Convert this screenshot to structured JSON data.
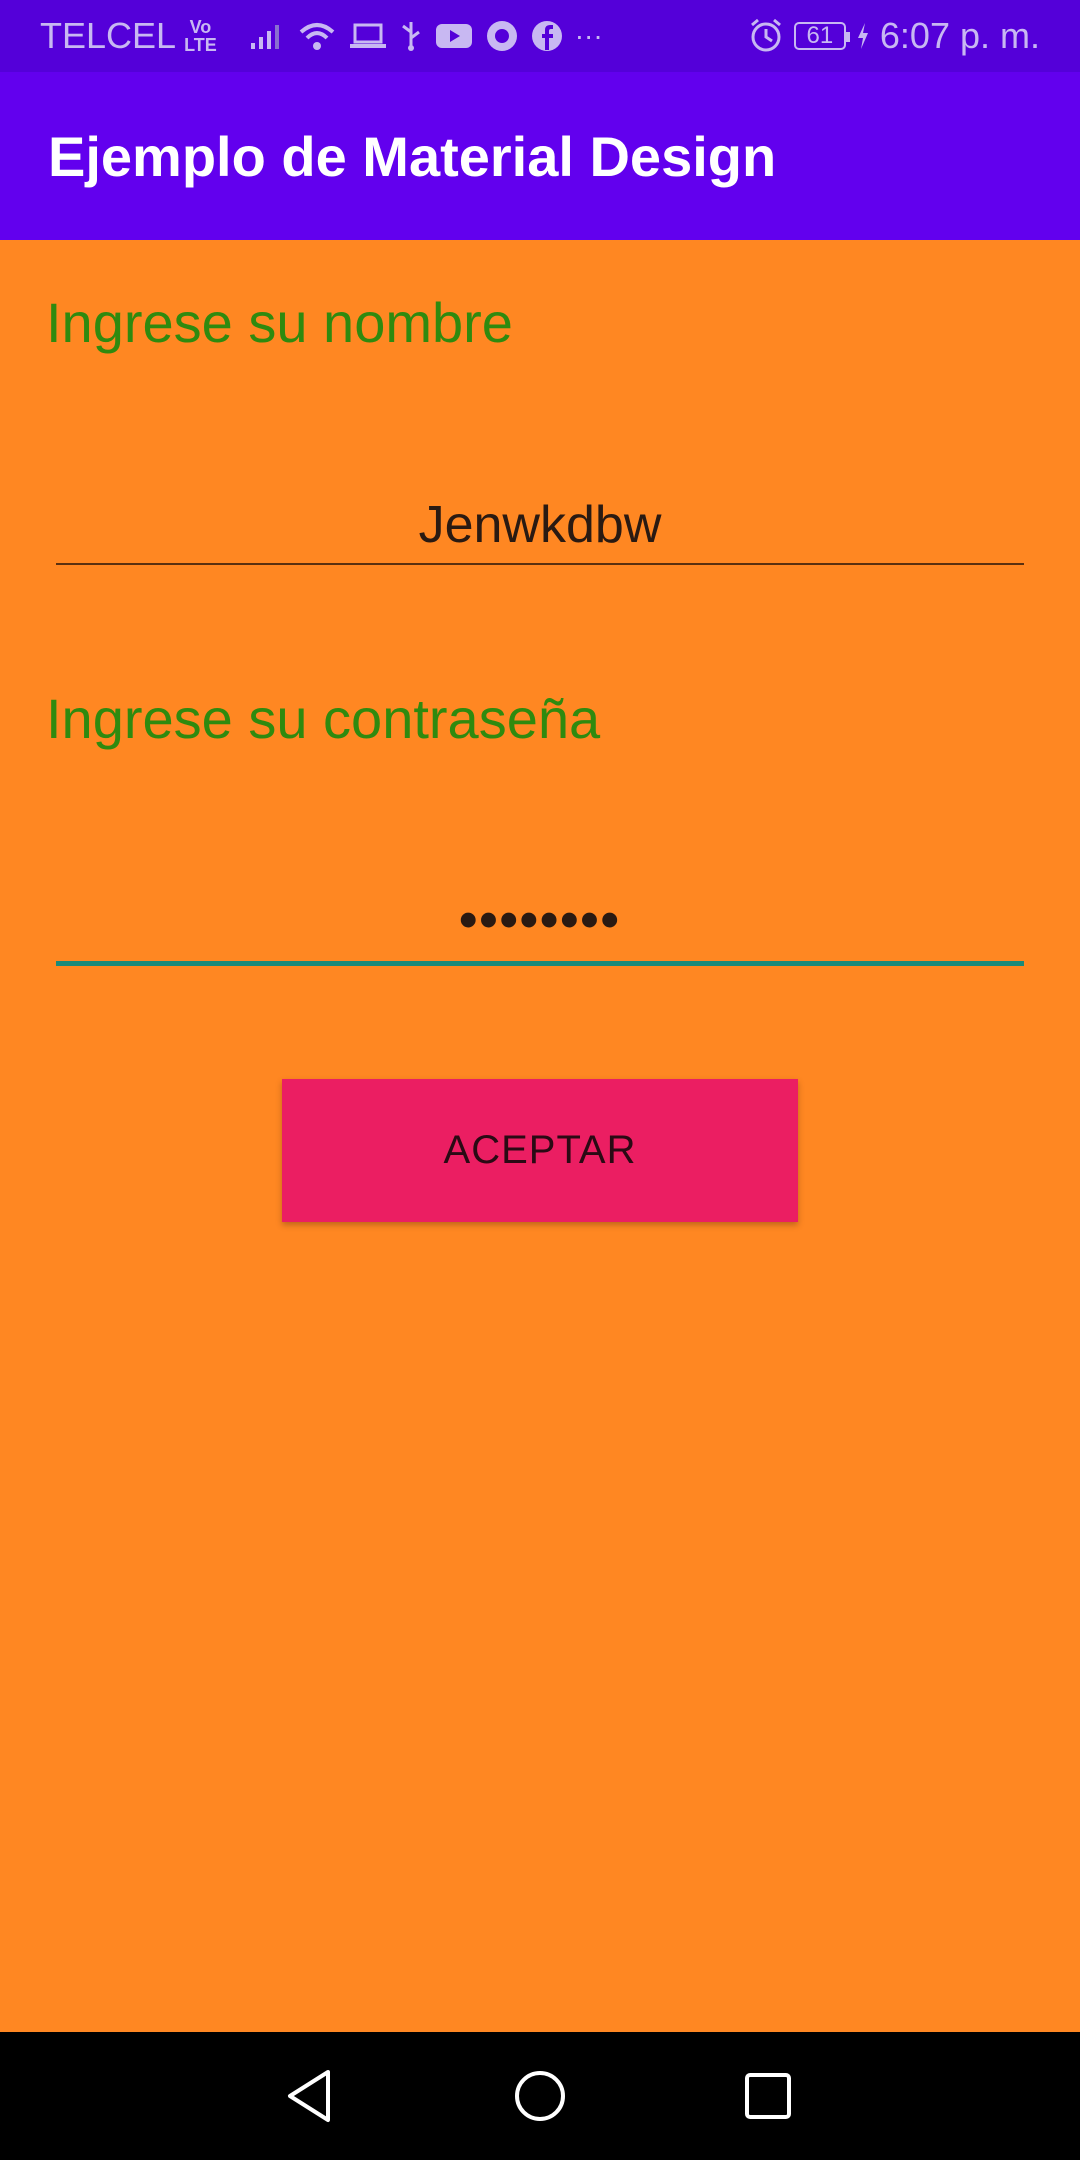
{
  "status_bar": {
    "carrier": "TELCEL",
    "volte_top": "Vo",
    "volte_bottom": "LTE",
    "battery": "61",
    "time": "6:07 p. m.",
    "more": "···",
    "icons": [
      "signal-icon",
      "wifi-icon",
      "laptop-icon",
      "usb-icon",
      "youtube-icon",
      "app-icon",
      "facebook-icon",
      "alarm-icon",
      "charging-icon"
    ]
  },
  "app_bar": {
    "title": "Ejemplo de Material Design"
  },
  "form": {
    "name_label": "Ingrese su nombre",
    "name_value": "Jenwkdbw",
    "password_label": "Ingrese su contraseña",
    "password_value": "••••••••",
    "accept_label": "ACEPTAR"
  },
  "colors": {
    "status_bar": "#5400d9",
    "app_bar": "#6200ee",
    "background": "#ff8722",
    "label": "#2f8a0f",
    "button": "#eb1e62",
    "focused_line": "#1a8a7a"
  },
  "nav_bar": {
    "icons": [
      "back-icon",
      "home-icon",
      "recents-icon"
    ]
  }
}
